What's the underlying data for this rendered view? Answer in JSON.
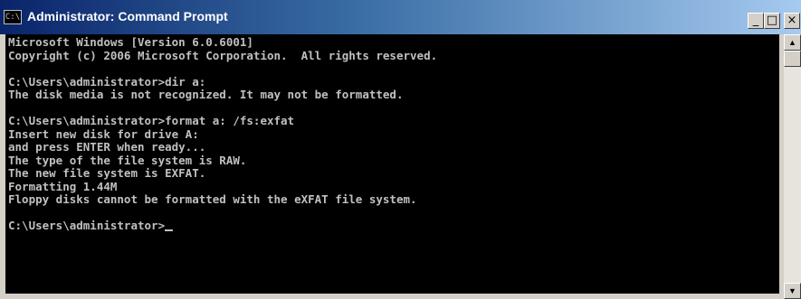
{
  "window": {
    "title": "Administrator: Command Prompt",
    "icon": "cmd-icon",
    "icon_text": "C:\\"
  },
  "title_buttons": {
    "minimize": "_",
    "maximize": "□",
    "close": "×"
  },
  "console": {
    "lines": [
      "Microsoft Windows [Version 6.0.6001]",
      "Copyright (c) 2006 Microsoft Corporation.  All rights reserved.",
      "",
      "C:\\Users\\administrator>dir a:",
      "The disk media is not recognized. It may not be formatted.",
      "",
      "C:\\Users\\administrator>format a: /fs:exfat",
      "Insert new disk for drive A:",
      "and press ENTER when ready...",
      "The type of the file system is RAW.",
      "The new file system is EXFAT.",
      "Formatting 1.44M",
      "Floppy disks cannot be formatted with the eXFAT file system.",
      "",
      "C:\\Users\\administrator>"
    ]
  },
  "scrollbar": {
    "up_arrow": "▲",
    "down_arrow": "▼"
  },
  "colors": {
    "console_bg": "#000000",
    "console_text": "#c0c0c0",
    "title_gradient_start": "#0a246a",
    "title_gradient_end": "#a6caf0"
  }
}
